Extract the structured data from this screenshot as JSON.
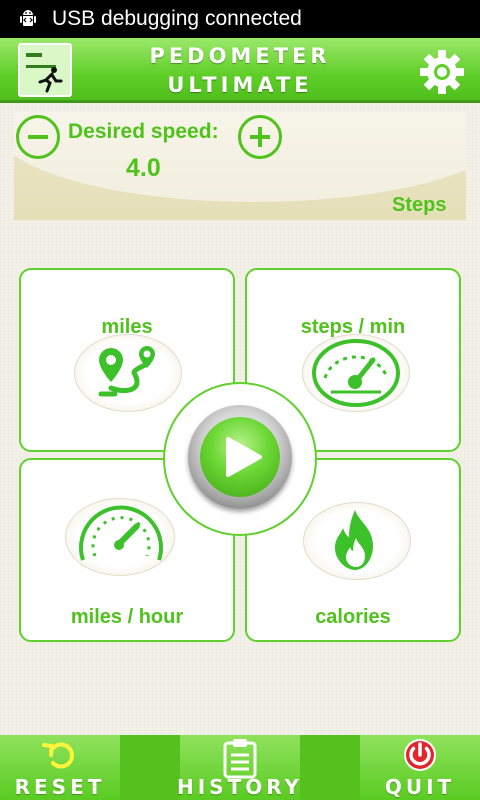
{
  "status_bar": {
    "text": "USB debugging connected",
    "icon": "android-debug-icon"
  },
  "header": {
    "title_line1": "PEDOMETER",
    "title_line2": "ULTIMATE",
    "logo_icon": "app-logo-icon",
    "settings_icon": "gear-icon"
  },
  "speed": {
    "label": "Desired speed:",
    "value": "4.0",
    "unit": "Steps",
    "decrease_icon": "minus-icon",
    "increase_icon": "plus-icon"
  },
  "tiles": [
    {
      "label": "miles",
      "icon": "route-pin-icon"
    },
    {
      "label": "steps / min",
      "icon": "speedometer-icon"
    },
    {
      "label": "miles / hour",
      "icon": "gauge-icon"
    },
    {
      "label": "calories",
      "icon": "flame-icon"
    }
  ],
  "play": {
    "icon": "play-icon"
  },
  "bottom_bar": [
    {
      "label": "RESET",
      "icon": "undo-icon"
    },
    {
      "label": "HISTORY",
      "icon": "clipboard-icon"
    },
    {
      "label": "QUIT",
      "icon": "power-icon"
    }
  ],
  "colors": {
    "accent": "#4fc21c",
    "header_green": "#5fce28",
    "quit_red": "#e3242b",
    "background": "#f3f1e7"
  }
}
